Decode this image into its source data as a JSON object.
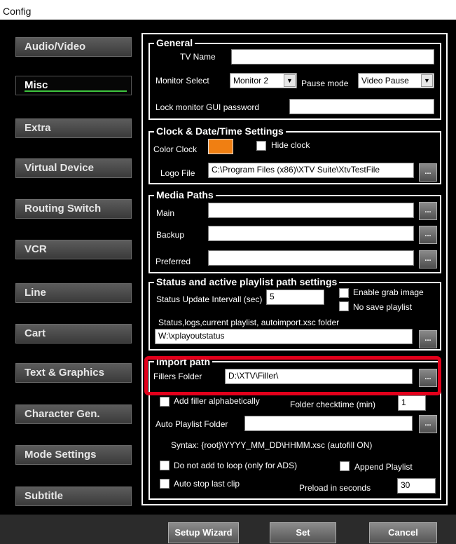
{
  "window_title": "Config",
  "sidebar": {
    "items": [
      {
        "label": "Audio/Video"
      },
      {
        "label": "Misc"
      },
      {
        "label": "Extra"
      },
      {
        "label": "Virtual Device"
      },
      {
        "label": "Routing Switch"
      },
      {
        "label": "VCR"
      },
      {
        "label": "Line"
      },
      {
        "label": "Cart"
      },
      {
        "label": "Text & Graphics"
      },
      {
        "label": "Character Gen."
      },
      {
        "label": "Mode Settings"
      },
      {
        "label": "Subtitle"
      }
    ],
    "active": "Misc"
  },
  "general": {
    "title": "General",
    "tv_name_label": "TV Name",
    "tv_name_value": "",
    "monitor_select_label": "Monitor Select",
    "monitor_select_value": "Monitor 2",
    "pause_mode_label": "Pause mode",
    "pause_mode_value": "Video Pause",
    "lock_password_label": "Lock monitor GUI password",
    "lock_password_value": ""
  },
  "clock": {
    "title": "Clock & Date/Time Settings",
    "color_clock_label": "Color Clock",
    "color_clock_value": "#f07f12",
    "hide_clock_label": "Hide clock",
    "logo_file_label": "Logo File",
    "logo_file_value": "C:\\Program Files (x86)\\XTV Suite\\XtvTestFile"
  },
  "media_paths": {
    "title": "Media Paths",
    "main_label": "Main",
    "main_value": "",
    "backup_label": "Backup",
    "backup_value": "",
    "preferred_label": "Preferred",
    "preferred_value": ""
  },
  "status": {
    "title": "Status and active playlist path settings",
    "interval_label": "Status Update Intervall (sec)",
    "interval_value": "5",
    "enable_grab_label": "Enable grab image",
    "no_save_label": "No save playlist",
    "folder_label": "Status,logs,current playlist, autoimport.xsc folder",
    "folder_value": "W:\\xplayoutstatus"
  },
  "import_path": {
    "title": "Import path",
    "fillers_label": "Fillers Folder",
    "fillers_value": "D:\\XTV\\Filler\\",
    "add_filler_label": "Add filler alphabetically",
    "folder_checktime_label": "Folder checktime (min)",
    "folder_checktime_value": "1",
    "auto_playlist_label": "Auto Playlist Folder",
    "auto_playlist_value": "",
    "syntax_text": "Syntax: {root}\\YYYY_MM_DD\\HHMM.xsc (autofill ON)",
    "no_loop_label": "Do not add to loop (only for ADS)",
    "append_label": "Append Playlist",
    "auto_stop_label": "Auto stop last clip",
    "preload_label": "Preload in seconds",
    "preload_value": "30"
  },
  "browse_label": "...",
  "buttons": {
    "setup_wizard": "Setup Wizard",
    "set": "Set",
    "cancel": "Cancel"
  },
  "colors": {
    "highlight": "#e3001b",
    "active_indicator": "#3ec43e"
  }
}
